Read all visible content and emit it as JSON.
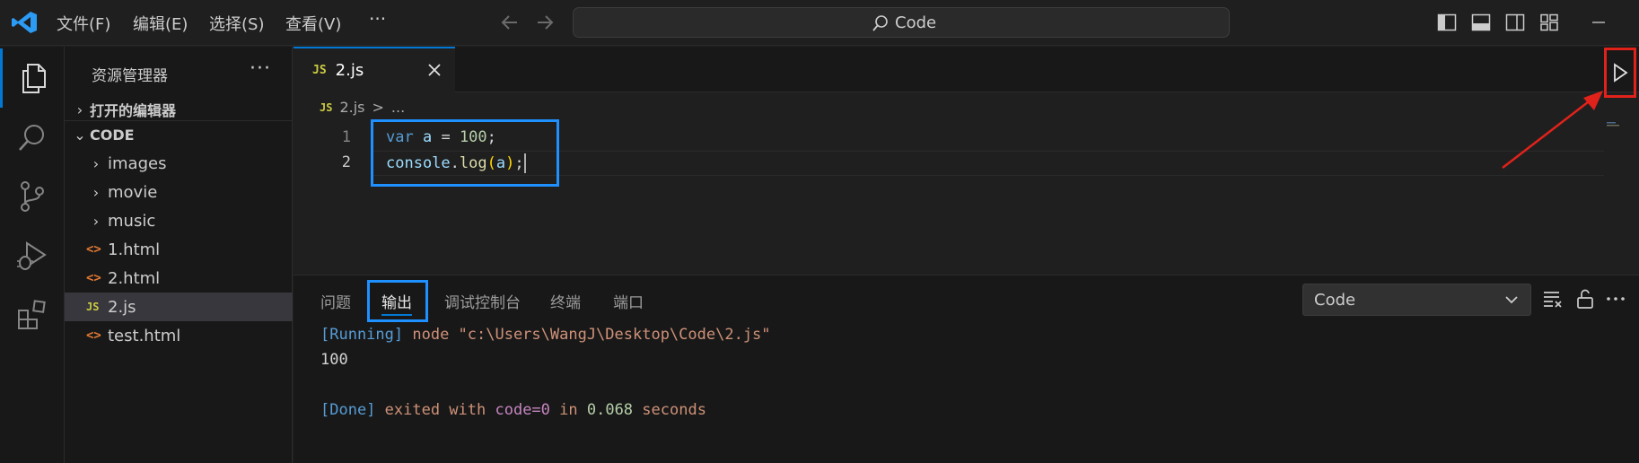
{
  "titlebar": {
    "menu": [
      "文件(F)",
      "编辑(E)",
      "选择(S)",
      "查看(V)",
      "···"
    ],
    "search_text": "Code"
  },
  "sidebar": {
    "title": "资源管理器",
    "more": "···",
    "open_editors": "打开的编辑器",
    "folder": "CODE",
    "items": [
      {
        "label": "images",
        "kind": "folder"
      },
      {
        "label": "movie",
        "kind": "folder"
      },
      {
        "label": "music",
        "kind": "folder"
      },
      {
        "label": "1.html",
        "kind": "html"
      },
      {
        "label": "2.html",
        "kind": "html"
      },
      {
        "label": "2.js",
        "kind": "js",
        "selected": true
      },
      {
        "label": "test.html",
        "kind": "html"
      }
    ]
  },
  "editor": {
    "tab_badge": "JS",
    "tab_label": "2.js",
    "breadcrumb_badge": "JS",
    "breadcrumb_file": "2.js",
    "breadcrumb_sep": ">",
    "breadcrumb_rest": "...",
    "line_numbers": [
      "1",
      "2"
    ],
    "code": {
      "line1": {
        "kw": "var",
        "name": "a",
        "eq": " = ",
        "num": "100",
        "end": ";"
      },
      "line2": {
        "obj": "console",
        "dot": ".",
        "fn": "log",
        "open": "(",
        "arg": "a",
        "close": ")",
        "end": ";"
      }
    }
  },
  "panel": {
    "tabs": [
      "问题",
      "输出",
      "调试控制台",
      "终端",
      "端口"
    ],
    "active_tab": "输出",
    "select_value": "Code",
    "output": {
      "l1_tag": "[Running]",
      "l1_cmd": " node \"c:\\Users\\WangJ\\Desktop\\Code\\2.js\"",
      "l2": "100",
      "l3_tag": "[Done]",
      "l3_a": " exited with ",
      "l3_code": "code=0",
      "l3_b": " in ",
      "l3_time": "0.068",
      "l3_c": " seconds"
    }
  },
  "colors": {
    "accent": "#0078d4",
    "annotation_red": "#e0221b",
    "annotation_blue": "#1e90ff"
  }
}
